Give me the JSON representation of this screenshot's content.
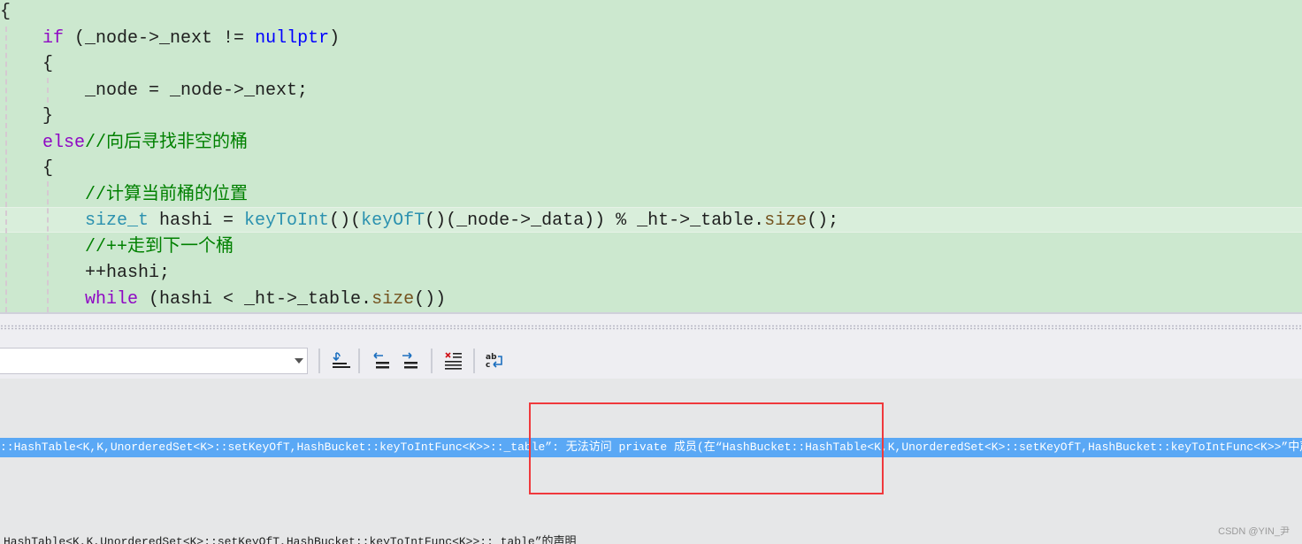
{
  "editor": {
    "lines": [
      {
        "indent": 0,
        "parts": [
          [
            "",
            "{"
          ]
        ]
      },
      {
        "indent": 1,
        "parts": [
          [
            "kw",
            "if"
          ],
          [
            "",
            "(_node->_next != "
          ],
          [
            "kb",
            "nullptr"
          ],
          [
            "",
            ")"
          ]
        ]
      },
      {
        "indent": 1,
        "parts": [
          [
            "",
            "{"
          ]
        ]
      },
      {
        "indent": 2,
        "parts": [
          [
            "",
            "_node = _node->_next;"
          ]
        ]
      },
      {
        "indent": 1,
        "parts": [
          [
            "",
            "}"
          ]
        ]
      },
      {
        "indent": 1,
        "parts": [
          [
            "kw",
            "else"
          ],
          [
            "cm",
            "//向后寻找非空的桶"
          ]
        ]
      },
      {
        "indent": 1,
        "parts": [
          [
            "",
            "{"
          ]
        ]
      },
      {
        "indent": 2,
        "parts": [
          [
            "cm",
            "//计算当前桶的位置"
          ]
        ]
      },
      {
        "indent": 2,
        "parts": [
          [
            "ty",
            "size_t"
          ],
          [
            "",
            " hashi = "
          ],
          [
            "ty",
            "keyToInt"
          ],
          [
            "",
            "()("
          ],
          [
            "ty",
            "keyOfT"
          ],
          [
            "",
            "()(_node->_data)) % _ht->_table."
          ],
          [
            "fn",
            "size"
          ],
          [
            "",
            "();"
          ]
        ]
      },
      {
        "indent": 2,
        "parts": [
          [
            "cm",
            "//++走到下一个桶"
          ]
        ]
      },
      {
        "indent": 2,
        "parts": [
          [
            "",
            "++hashi;"
          ]
        ]
      },
      {
        "indent": 2,
        "parts": [
          [
            "kw",
            "while"
          ],
          [
            "",
            " (hashi < _ht->_table."
          ],
          [
            "fn",
            "size"
          ],
          [
            "",
            "())"
          ]
        ]
      }
    ]
  },
  "output": {
    "selected_line": "::HashTable<K,K,UnorderedSet<K>::setKeyOfT,HashBucket::keyToIntFunc<K>>::_table”: 无法访问 private 成员(在“HashBucket::HashTable<K,K,UnorderedSet<K>::setKeyOfT,HashBucket::keyToIntFunc<K>>”中声明)",
    "next_line": "HashTable<K,K,UnorderedSet<K>::setKeyOfT,HashBucket::keyToIntFunc<K>>::_table”的声明"
  },
  "toolbar": {
    "icons": [
      "go-to-line-icon",
      "previous-message-icon",
      "next-message-icon",
      "clear-all-icon",
      "word-wrap-icon"
    ]
  },
  "watermark": "CSDN @YIN_尹",
  "colors": {
    "editor_bg": "#cce8cf",
    "selection": "#5aa8f5",
    "annotation_box": "#f0393c"
  }
}
